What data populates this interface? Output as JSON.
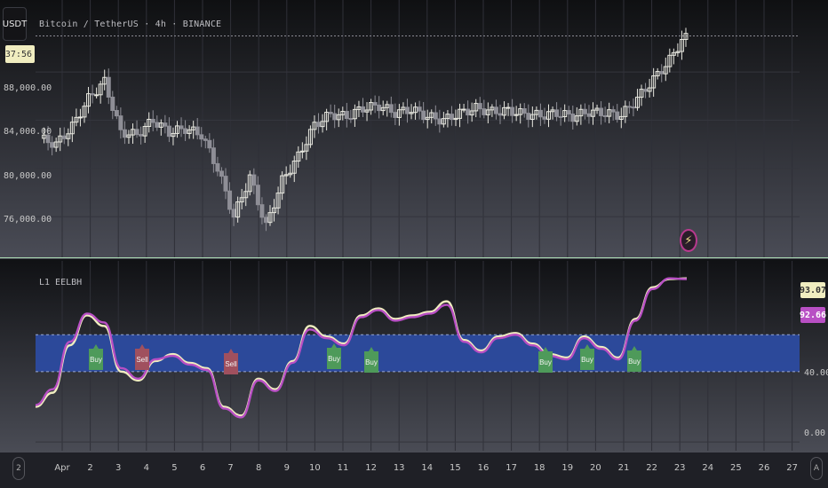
{
  "header": {
    "currency_chip": "USDT",
    "symbol_title": "Bitcoin / TetherUS · 4h · BINANCE",
    "countdown": "37:56"
  },
  "price_axis": {
    "ticks": [
      "88,000.00",
      "84,000.00",
      "80,000.00",
      "76,000.00"
    ]
  },
  "indicator": {
    "title": "L1 EELBH",
    "axis_ticks": [
      "40.00",
      "0.00"
    ],
    "value_1": "93.07",
    "value_2": "92.66",
    "color_1": "#f0edc0",
    "color_2": "#b84fc4",
    "band_color": "#2c4ba0",
    "signal_buy_color": "#4e9a5a",
    "signal_sell_color": "#a0505e"
  },
  "x_axis": {
    "labels": [
      "Apr",
      "2",
      "3",
      "4",
      "5",
      "6",
      "7",
      "8",
      "9",
      "10",
      "11",
      "12",
      "13",
      "14",
      "15",
      "16",
      "17",
      "18",
      "19",
      "20",
      "21",
      "22",
      "23",
      "24",
      "25",
      "26",
      "27"
    ]
  },
  "nav": {
    "left_label": "2",
    "right_label": "A"
  },
  "icons": {
    "alert": "lightning-bolt-icon"
  },
  "chart_data": [
    {
      "type": "candlestick",
      "title": "Bitcoin / TetherUS · 4h · BINANCE",
      "ylim": [
        73000,
        92500
      ],
      "grid": true,
      "x": [
        "Apr",
        "2",
        "3",
        "4",
        "5",
        "6",
        "7",
        "8",
        "9",
        "10",
        "11",
        "12",
        "13",
        "14",
        "15",
        "16",
        "17",
        "18",
        "19",
        "20",
        "21",
        "22",
        "23"
      ],
      "series": [
        {
          "close": [
            82500,
            82000,
            83500,
            85800,
            87200,
            83000,
            82800,
            84000,
            83000,
            83300,
            82800,
            80000,
            76000,
            79300,
            75200,
            79000,
            81000,
            83600,
            84500,
            84300,
            85000,
            85200,
            84600,
            84900,
            84300,
            84000,
            84600,
            85000,
            84700,
            84800,
            84500,
            84400,
            84600,
            84300,
            84700,
            84600,
            84400,
            85800,
            87400,
            89000,
            91200
          ]
        }
      ]
    },
    {
      "type": "line",
      "title": "L1 EELBH",
      "ylim": [
        -5,
        100
      ],
      "band": [
        40,
        61
      ],
      "x": [
        "Apr",
        "2",
        "3",
        "4",
        "5",
        "6",
        "7",
        "8",
        "9",
        "10",
        "11",
        "12",
        "13",
        "14",
        "15",
        "16",
        "17",
        "18",
        "19",
        "20",
        "21",
        "22",
        "23"
      ],
      "series": [
        {
          "values": [
            20,
            28,
            55,
            72,
            66,
            40,
            35,
            46,
            50,
            45,
            42,
            20,
            15,
            36,
            30,
            46,
            66,
            60,
            56,
            72,
            76,
            70,
            72,
            74,
            80,
            58,
            52,
            60,
            62,
            56,
            50,
            48,
            60,
            54,
            48,
            70,
            88,
            92.66,
            93.07
          ]
        },
        {
          "values": [
            21,
            30,
            57,
            73,
            68,
            42,
            36,
            47,
            49,
            44,
            41,
            19,
            14,
            35,
            29,
            45,
            64,
            59,
            55,
            71,
            75,
            69,
            71,
            73,
            78,
            57,
            51,
            59,
            61,
            55,
            49,
            47,
            59,
            53,
            47,
            69,
            87,
            93.07,
            92.66
          ]
        }
      ],
      "annotations": [
        "Buy",
        "Sell",
        "Sell",
        "Buy",
        "Buy",
        "Buy",
        "Buy",
        "Buy"
      ]
    }
  ]
}
